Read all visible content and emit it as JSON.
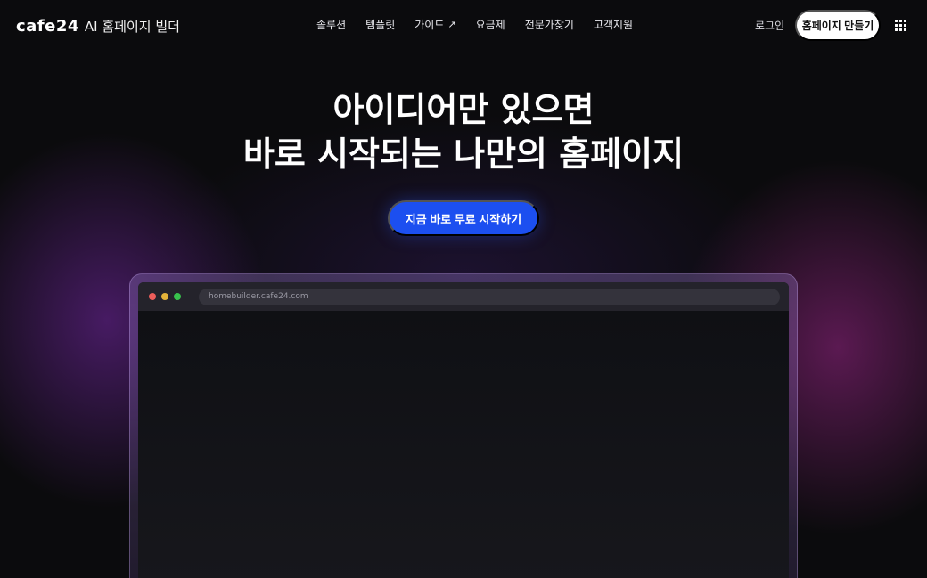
{
  "header": {
    "logo_mark": "cafe24",
    "logo_text": "AI 홈페이지 빌더",
    "nav": [
      {
        "label": "솔루션"
      },
      {
        "label": "템플릿"
      },
      {
        "label": "가이드",
        "icon": "external-arrow-icon"
      },
      {
        "label": "요금제"
      },
      {
        "label": "전문가찾기"
      },
      {
        "label": "고객지원"
      }
    ],
    "login_label": "로그인",
    "cta_label": "홈페이지 만들기",
    "menu_icon": "grid-menu-icon"
  },
  "hero": {
    "title_line1": "아이디어만 있으면",
    "title_line2": "바로 시작되는 나만의 홈페이지",
    "cta_label": "지금 바로 무료 시작하기"
  },
  "browser": {
    "url": "homebuilder.cafe24.com"
  },
  "colors": {
    "accent": "#1c4ff0",
    "background": "#0b0b0d"
  }
}
